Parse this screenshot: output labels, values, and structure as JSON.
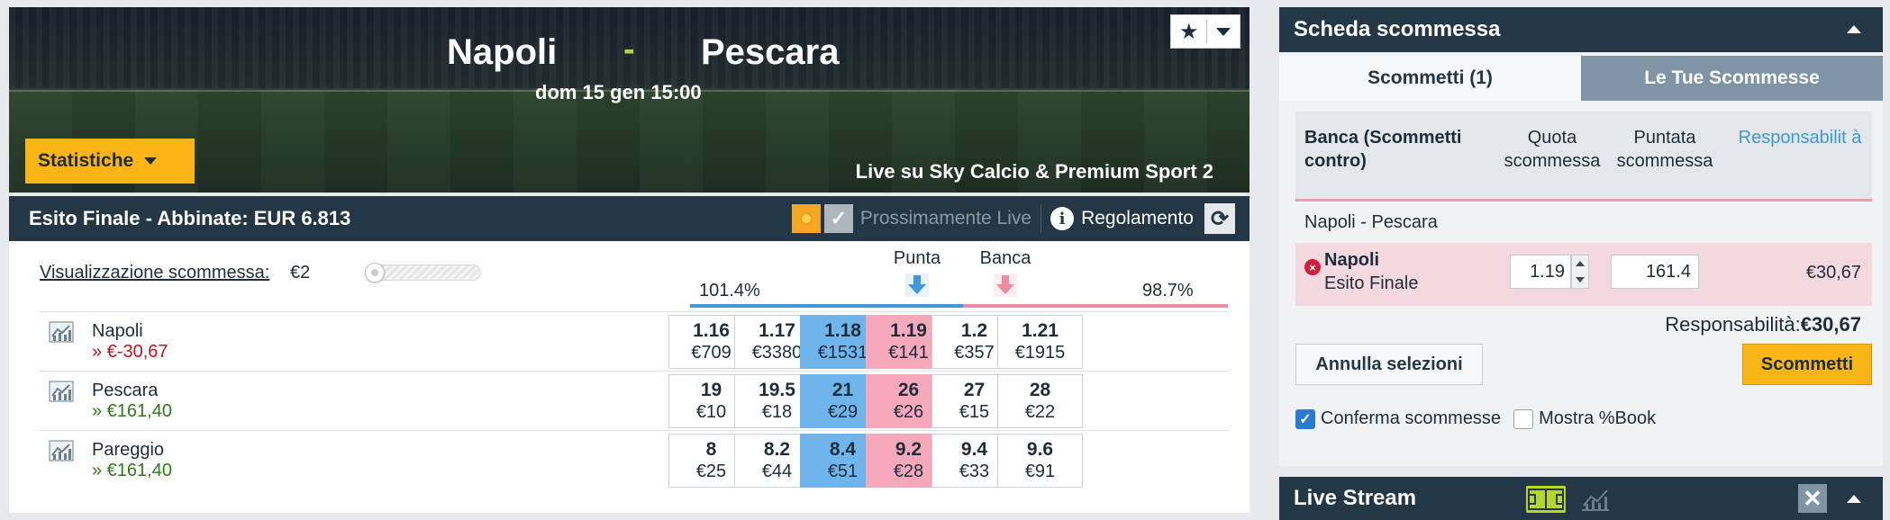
{
  "event": {
    "home": "Napoli",
    "dash": "-",
    "away": "Pescara",
    "date": "dom 15 gen 15:00",
    "tv": "Live su Sky Calcio & Premium Sport 2",
    "stats_label": "Statistiche"
  },
  "market": {
    "title": "Esito Finale - Abbinate: EUR 6.813",
    "coming_live": "Prossimamente Live",
    "rules": "Regolamento",
    "view_label": "Visualizzazione scommessa:",
    "view_value": "€2",
    "back_label": "Punta",
    "lay_label": "Banca",
    "overround_back": "101.4%",
    "overround_lay": "98.7%"
  },
  "runners": [
    {
      "name": "Napoli",
      "pl": "» €-30,67",
      "pl_sign": "neg",
      "prices": [
        {
          "odd": "1.16",
          "amount": "€709"
        },
        {
          "odd": "1.17",
          "amount": "€3380"
        },
        {
          "odd": "1.18",
          "amount": "€1531"
        },
        {
          "odd": "1.19",
          "amount": "€141"
        },
        {
          "odd": "1.2",
          "amount": "€357"
        },
        {
          "odd": "1.21",
          "amount": "€1915"
        }
      ]
    },
    {
      "name": "Pescara",
      "pl": "» €161,40",
      "pl_sign": "pos",
      "prices": [
        {
          "odd": "19",
          "amount": "€10"
        },
        {
          "odd": "19.5",
          "amount": "€18"
        },
        {
          "odd": "21",
          "amount": "€29"
        },
        {
          "odd": "26",
          "amount": "€26"
        },
        {
          "odd": "27",
          "amount": "€15"
        },
        {
          "odd": "28",
          "amount": "€22"
        }
      ]
    },
    {
      "name": "Pareggio",
      "pl": "» €161,40",
      "pl_sign": "pos",
      "prices": [
        {
          "odd": "8",
          "amount": "€25"
        },
        {
          "odd": "8.2",
          "amount": "€44"
        },
        {
          "odd": "8.4",
          "amount": "€51"
        },
        {
          "odd": "9.2",
          "amount": "€28"
        },
        {
          "odd": "9.4",
          "amount": "€33"
        },
        {
          "odd": "9.6",
          "amount": "€91"
        }
      ]
    }
  ],
  "betslip": {
    "title": "Scheda scommessa",
    "tab_bets": "Scommetti (1)",
    "tab_mybets": "Le Tue Scommesse",
    "col_lay": "Banca (Scommetti contro)",
    "col_odds": "Quota scommessa",
    "col_stake": "Puntata scommessa",
    "col_liability": "Responsabilit à",
    "market_name": "Napoli - Pescara",
    "bet_runner": "Napoli",
    "bet_market": "Esito Finale",
    "odds_value": "1.19",
    "stake_value": "161.4",
    "bet_liability": "€30,67",
    "total_liability_label": "Responsabilità:",
    "total_liability_value": "€30,67",
    "cancel_label": "Annulla selezioni",
    "place_label": "Scommetti",
    "confirm_label": "Conferma scommesse",
    "confirm_checked": true,
    "book_label": "Mostra %Book",
    "book_checked": false
  },
  "live_stream": {
    "title": "Live Stream"
  },
  "colors": {
    "back": "#6fb5eb",
    "lay": "#f6a9bb",
    "header": "#243746",
    "accent": "#f8b515"
  }
}
